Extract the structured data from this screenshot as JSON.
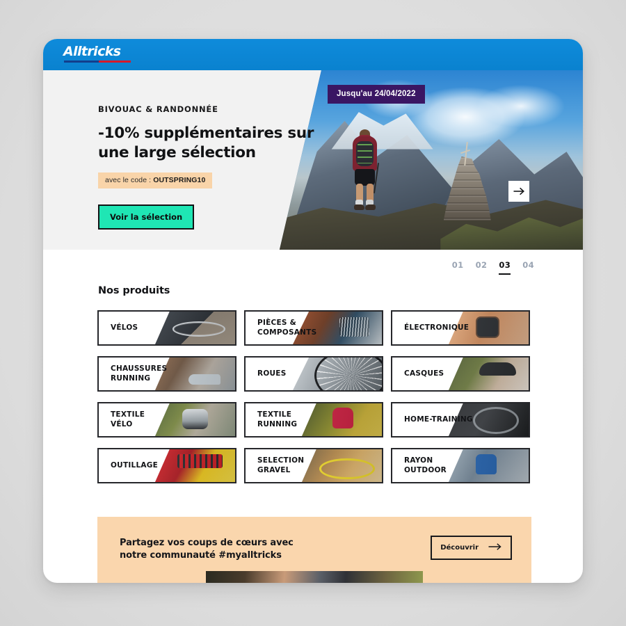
{
  "brand": {
    "logo_text": "Alltricks",
    "bar_color": "#0e87d6"
  },
  "hero": {
    "eyebrow": "BIVOUAC & RANDONNÉE",
    "title": "-10% supplémentaires sur une large sélection",
    "promo_prefix": "avec le code : ",
    "promo_code": "OUTSPRING10",
    "cta_label": "Voir la sélection",
    "cta_color": "#1fe6b4",
    "date_badge": "Jusqu'au 24/04/2022",
    "date_badge_color": "#3a1663",
    "next_slide_icon": "arrow-right-icon"
  },
  "pager": {
    "items": [
      {
        "label": "01",
        "active": false
      },
      {
        "label": "02",
        "active": false
      },
      {
        "label": "03",
        "active": true
      },
      {
        "label": "04",
        "active": false
      }
    ]
  },
  "products": {
    "title": "Nos produits",
    "cards": [
      {
        "label": "VÉLOS",
        "photo": "ph-velos"
      },
      {
        "label": "PIÈCES &\nCOMPOSANTS",
        "photo": "ph-pieces"
      },
      {
        "label": "ÉLECTRONIQUE",
        "photo": "ph-elec"
      },
      {
        "label": "CHAUSSURES\nRUNNING",
        "photo": "ph-chauss"
      },
      {
        "label": "ROUES",
        "photo": "ph-roues"
      },
      {
        "label": "CASQUES",
        "photo": "ph-casques"
      },
      {
        "label": "TEXTILE\nVÉLO",
        "photo": "ph-txvelo"
      },
      {
        "label": "TEXTILE\nRUNNING",
        "photo": "ph-txrun"
      },
      {
        "label": "HOME-TRAINING",
        "photo": "ph-home"
      },
      {
        "label": "OUTILLAGE",
        "photo": "ph-outil"
      },
      {
        "label": "SELECTION\nGRAVEL",
        "photo": "ph-gravel"
      },
      {
        "label": "RAYON\nOUTDOOR",
        "photo": "ph-outdoor"
      }
    ]
  },
  "community": {
    "title": "Partagez vos coups de cœurs avec\nnotre communauté #myalltricks",
    "button_label": "Découvrir",
    "button_icon": "arrow-right-icon",
    "background_color": "#fad6ad"
  }
}
